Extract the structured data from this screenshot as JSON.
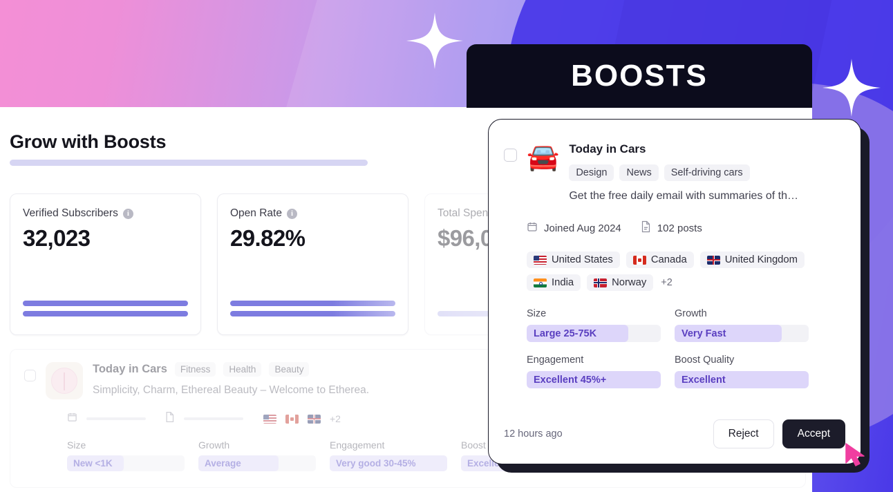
{
  "hero": {
    "banner_title": "BOOSTS",
    "accent_gradient_start": "#f48fd6",
    "accent_gradient_end": "#4a39e8",
    "banner_bg": "#0c0c1c"
  },
  "page": {
    "title": "Grow with Boosts"
  },
  "stats": [
    {
      "label": "Verified Subscribers",
      "value": "32,023",
      "info": "i",
      "muted": false
    },
    {
      "label": "Open Rate",
      "value": "29.82%",
      "info": "i",
      "muted": false
    },
    {
      "label": "Total Spend",
      "value": "$96,0",
      "info": "",
      "muted": true
    }
  ],
  "list_row": {
    "name": "Today in Cars",
    "chips": [
      "Fitness",
      "Health",
      "Beauty"
    ],
    "description": "Simplicity, Charm, Ethereal Beauty – Welcome to Etherea.",
    "extra_countries": "+2",
    "metrics": [
      {
        "key": "Size",
        "value": "New <1K",
        "fill_pct": 48
      },
      {
        "key": "Growth",
        "value": "Average",
        "fill_pct": 68
      },
      {
        "key": "Engagement",
        "value": "Very good 30-45%",
        "fill_pct": 100
      },
      {
        "key": "Boost Quality",
        "value": "Excellent",
        "fill_pct": 100
      }
    ]
  },
  "modal": {
    "emoji": "🚘",
    "name": "Today in Cars",
    "chips": [
      "Design",
      "News",
      "Self-driving cars"
    ],
    "description": "Get the free daily email with summaries of th…",
    "joined": "Joined Aug 2024",
    "posts": "102 posts",
    "countries": [
      {
        "name": "United States",
        "flag": "us"
      },
      {
        "name": "Canada",
        "flag": "ca"
      },
      {
        "name": "United Kingdom",
        "flag": "uk"
      },
      {
        "name": "India",
        "flag": "in"
      },
      {
        "name": "Norway",
        "flag": "no"
      }
    ],
    "extra_countries": "+2",
    "metrics": [
      {
        "key": "Size",
        "value": "Large 25-75K",
        "fill_pct": 76
      },
      {
        "key": "Growth",
        "value": "Very Fast",
        "fill_pct": 80
      },
      {
        "key": "Engagement",
        "value": "Excellent 45%+",
        "fill_pct": 100
      },
      {
        "key": "Boost Quality",
        "value": "Excellent",
        "fill_pct": 100
      }
    ],
    "timestamp": "12 hours ago",
    "reject_label": "Reject",
    "accept_label": "Accept",
    "accent_badge_bg": "#ddd6fa",
    "accent_badge_text": "#5a3fc0",
    "accept_bg": "#1c1c2a",
    "cursor_color": "#f03ea0"
  }
}
